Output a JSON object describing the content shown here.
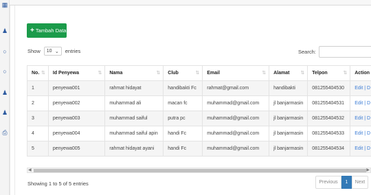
{
  "toolbar": {
    "add_label": "Tambah Data"
  },
  "length": {
    "show": "Show",
    "value": "10",
    "entries": "entries"
  },
  "search": {
    "label": "Search:",
    "value": ""
  },
  "table": {
    "headers": [
      "No.",
      "Id Penyewa",
      "Nama",
      "Club",
      "Email",
      "Alamat",
      "Telpon",
      "Action"
    ],
    "rows": [
      [
        "1",
        "penyewa001",
        "rahmat hidayat",
        "handibakti Fc",
        "rahmat@gmail.com",
        "handibakti",
        "081255404530",
        "Edit | D"
      ],
      [
        "2",
        "penyewa002",
        "muhammad ali",
        "macan fc",
        "muhammad@gmail.com",
        "jl banjarmasin",
        "081255404531",
        "Edit | D"
      ],
      [
        "3",
        "penyewa003",
        "muhammad saiful",
        "putra pc",
        "muhammad@gmail.com",
        "jl banjarmasin",
        "081255404532",
        "Edit | D"
      ],
      [
        "4",
        "penyewa004",
        "muhammad saiful apin",
        "handi Fc",
        "muhammad@gmail.com",
        "jl banjarmasin",
        "081255404533",
        "Edit | D"
      ],
      [
        "5",
        "penyewa005",
        "rahmat hidayat ayani",
        "handi Fc",
        "muhammad@gmail.com",
        "jl banjarmasin",
        "081255404534",
        "Edit | D"
      ]
    ]
  },
  "footer": {
    "info": "Showing 1 to 5 of 5 entries",
    "previous": "Previous",
    "page": "1",
    "next": "Next"
  },
  "sidebar": {
    "icons": [
      "dashboard-icon",
      "user-icon",
      "circle-icon",
      "circle-icon",
      "user-icon",
      "user-icon",
      "print-icon"
    ]
  },
  "colors": {
    "add_button": "#1b9b4a",
    "active_page": "#337ab7",
    "link": "#3a7bd5"
  }
}
